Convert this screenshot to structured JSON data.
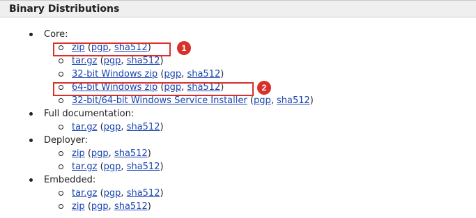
{
  "section": {
    "title": "Binary Distributions"
  },
  "groups": [
    {
      "label": "Core:",
      "items": [
        {
          "name": "zip",
          "pgp": "pgp",
          "sha": "sha512"
        },
        {
          "name": "tar.gz",
          "pgp": "pgp",
          "sha": "sha512"
        },
        {
          "name": "32-bit Windows zip",
          "pgp": "pgp",
          "sha": "sha512"
        },
        {
          "name": "64-bit Windows zip",
          "pgp": "pgp",
          "sha": "sha512"
        },
        {
          "name": "32-bit/64-bit Windows Service Installer",
          "pgp": "pgp",
          "sha": "sha512"
        }
      ]
    },
    {
      "label": "Full documentation:",
      "items": [
        {
          "name": "tar.gz",
          "pgp": "pgp",
          "sha": "sha512"
        }
      ]
    },
    {
      "label": "Deployer:",
      "items": [
        {
          "name": "zip",
          "pgp": "pgp",
          "sha": "sha512"
        },
        {
          "name": "tar.gz",
          "pgp": "pgp",
          "sha": "sha512"
        }
      ]
    },
    {
      "label": "Embedded:",
      "items": [
        {
          "name": "tar.gz",
          "pgp": "pgp",
          "sha": "sha512"
        },
        {
          "name": "zip",
          "pgp": "pgp",
          "sha": "sha512"
        }
      ]
    }
  ],
  "annotations": {
    "badge_1": "1",
    "badge_2": "2",
    "color": "#d9302a"
  },
  "colors": {
    "link": "#1a45b0",
    "header_bg": "#efefef"
  }
}
